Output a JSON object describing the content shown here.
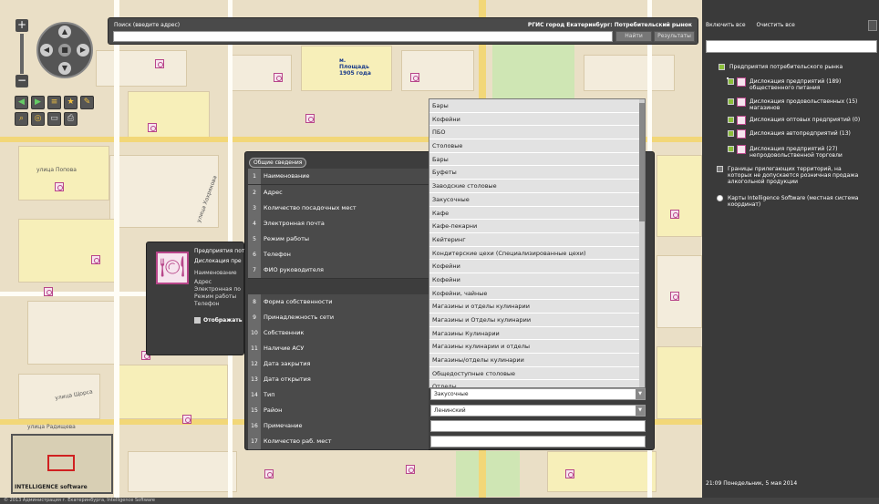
{
  "search": {
    "label": "Поиск (введите адрес)",
    "title": "РГИС город Екатеринбург: Потребительский рынок",
    "find_btn": "Найти",
    "results_btn": "Результаты",
    "value": ""
  },
  "map_labels": {
    "square": "м. Площадь 1905 года",
    "street1": "улица Попова",
    "street2": "улица Хохрякова",
    "street3": "улица Радищева",
    "street4": "улица Щорса"
  },
  "form": {
    "tab": "Общие сведения",
    "rows": [
      {
        "num": "1",
        "label": "Наименование"
      },
      {
        "num": "2",
        "label": "Адрес"
      },
      {
        "num": "3",
        "label": "Количество посадочных мест"
      },
      {
        "num": "4",
        "label": "Электронная почта"
      },
      {
        "num": "5",
        "label": "Режим работы"
      },
      {
        "num": "6",
        "label": "Телефон"
      },
      {
        "num": "7",
        "label": "ФИО руководителя"
      },
      {
        "num": "8",
        "label": "Форма собственности"
      },
      {
        "num": "9",
        "label": "Принадлежность сети"
      },
      {
        "num": "10",
        "label": "Собственник"
      },
      {
        "num": "11",
        "label": "Наличие АСУ"
      },
      {
        "num": "12",
        "label": "Дата закрытия"
      },
      {
        "num": "13",
        "label": "Дата открытия"
      },
      {
        "num": "14",
        "label": "Тип"
      },
      {
        "num": "15",
        "label": "Район"
      },
      {
        "num": "16",
        "label": "Примечание"
      },
      {
        "num": "17",
        "label": "Количество раб. мест"
      }
    ],
    "type_value": "Закусочные",
    "district_value": "Ленинский"
  },
  "dropdown": [
    "Бары",
    "Кофейни",
    "ПБО",
    "Столовые",
    "Бары",
    "Буфеты",
    "Заводские столовые",
    "Закусочные",
    "Кафе",
    "Кафе-пекарни",
    "Кейтеринг",
    "Кондитерские цехи (Специализированные цехи)",
    "Кофейни",
    "Кофейни",
    "Кофейни, чайные",
    "Магазины и отделы кулинарии",
    "Магазины и Отделы кулинарии",
    "Магазины Кулинарии",
    "Магазины кулинарии и отделы",
    "Магазины/отделы кулинарии",
    "Общедоступные столовые",
    "Отделы"
  ],
  "popup": {
    "line1": "Предприятия пот",
    "line2": "Дислокация пре",
    "line3": "Наименование",
    "line4": "Адрес",
    "line5": "Электронная по",
    "line6": "Режим работы",
    "line7": "Телефон",
    "checkbox": "Отображать"
  },
  "panel": {
    "enable_all": "Включить все",
    "clear_all": "Очистить все",
    "group": "Предприятия потребительского рынка",
    "layers": [
      "Дислокация предприятий (189) общественного питания",
      "Дислокация продовольственных (15) магазинов",
      "Дислокация оптовых предприятий (0)",
      "Дислокация автопредприятий (13)",
      "Дислокация предприятий (27) непродовольственной торговли"
    ],
    "borders": "Границы прилегающих территорий, на которых не допускается розничная продажа алкогольной продукции",
    "maps": "Карты Intelligence Software (местная система координат)",
    "datetime": "21:09 Понедельник, 5 мая 2014"
  },
  "overview_logo": "INTELLIGENCE software",
  "bottom_text": "© 2013 Администрация г. Екатеринбурга, Intelligence Software"
}
